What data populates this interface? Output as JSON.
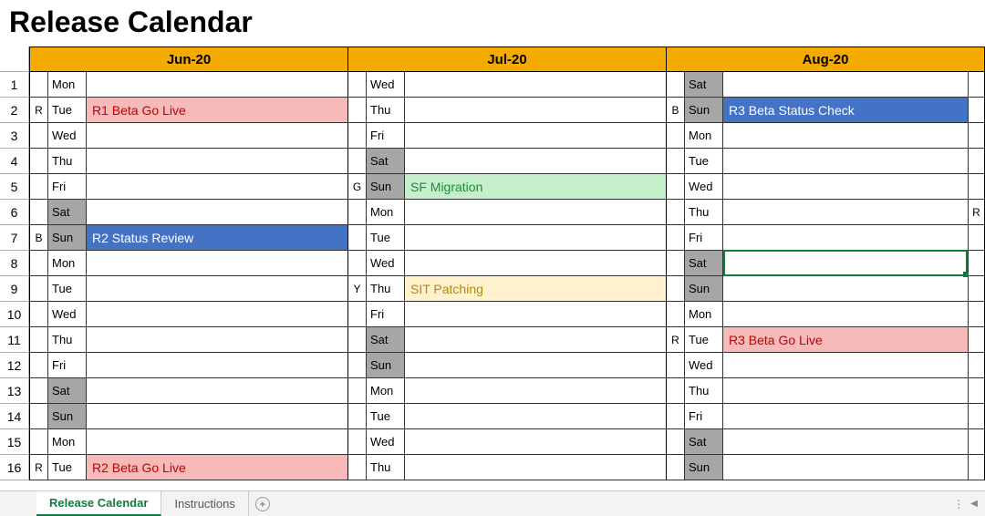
{
  "title": "Release Calendar",
  "months": [
    {
      "label": "Jun-20",
      "rows": [
        {
          "tag": "",
          "dow": "Mon",
          "wk": false,
          "event": "",
          "style": "",
          "trail": ""
        },
        {
          "tag": "R",
          "dow": "Tue",
          "wk": false,
          "event": "R1 Beta Go Live",
          "style": "red",
          "trail": ""
        },
        {
          "tag": "",
          "dow": "Wed",
          "wk": false,
          "event": "",
          "style": "",
          "trail": ""
        },
        {
          "tag": "",
          "dow": "Thu",
          "wk": false,
          "event": "",
          "style": "",
          "trail": ""
        },
        {
          "tag": "",
          "dow": "Fri",
          "wk": false,
          "event": "",
          "style": "",
          "trail": ""
        },
        {
          "tag": "",
          "dow": "Sat",
          "wk": true,
          "event": "",
          "style": "",
          "trail": ""
        },
        {
          "tag": "B",
          "dow": "Sun",
          "wk": true,
          "event": "R2 Status Review",
          "style": "blue",
          "trail": ""
        },
        {
          "tag": "",
          "dow": "Mon",
          "wk": false,
          "event": "",
          "style": "",
          "trail": ""
        },
        {
          "tag": "",
          "dow": "Tue",
          "wk": false,
          "event": "",
          "style": "",
          "trail": ""
        },
        {
          "tag": "",
          "dow": "Wed",
          "wk": false,
          "event": "",
          "style": "",
          "trail": ""
        },
        {
          "tag": "",
          "dow": "Thu",
          "wk": false,
          "event": "",
          "style": "",
          "trail": ""
        },
        {
          "tag": "",
          "dow": "Fri",
          "wk": false,
          "event": "",
          "style": "",
          "trail": ""
        },
        {
          "tag": "",
          "dow": "Sat",
          "wk": true,
          "event": "",
          "style": "",
          "trail": ""
        },
        {
          "tag": "",
          "dow": "Sun",
          "wk": true,
          "event": "",
          "style": "",
          "trail": ""
        },
        {
          "tag": "",
          "dow": "Mon",
          "wk": false,
          "event": "",
          "style": "",
          "trail": ""
        },
        {
          "tag": "R",
          "dow": "Tue",
          "wk": false,
          "event": "R2 Beta Go Live",
          "style": "red",
          "trail": ""
        }
      ]
    },
    {
      "label": "Jul-20",
      "rows": [
        {
          "tag": "",
          "dow": "Wed",
          "wk": false,
          "event": "",
          "style": "",
          "trail": ""
        },
        {
          "tag": "",
          "dow": "Thu",
          "wk": false,
          "event": "",
          "style": "",
          "trail": ""
        },
        {
          "tag": "",
          "dow": "Fri",
          "wk": false,
          "event": "",
          "style": "",
          "trail": ""
        },
        {
          "tag": "",
          "dow": "Sat",
          "wk": true,
          "event": "",
          "style": "",
          "trail": ""
        },
        {
          "tag": "G",
          "dow": "Sun",
          "wk": true,
          "event": "SF Migration",
          "style": "green",
          "trail": ""
        },
        {
          "tag": "",
          "dow": "Mon",
          "wk": false,
          "event": "",
          "style": "",
          "trail": ""
        },
        {
          "tag": "",
          "dow": "Tue",
          "wk": false,
          "event": "",
          "style": "",
          "trail": ""
        },
        {
          "tag": "",
          "dow": "Wed",
          "wk": false,
          "event": "",
          "style": "",
          "trail": ""
        },
        {
          "tag": "Y",
          "dow": "Thu",
          "wk": false,
          "event": "SIT Patching",
          "style": "yellow",
          "trail": ""
        },
        {
          "tag": "",
          "dow": "Fri",
          "wk": false,
          "event": "",
          "style": "",
          "trail": ""
        },
        {
          "tag": "",
          "dow": "Sat",
          "wk": true,
          "event": "",
          "style": "",
          "trail": ""
        },
        {
          "tag": "",
          "dow": "Sun",
          "wk": true,
          "event": "",
          "style": "",
          "trail": ""
        },
        {
          "tag": "",
          "dow": "Mon",
          "wk": false,
          "event": "",
          "style": "",
          "trail": ""
        },
        {
          "tag": "",
          "dow": "Tue",
          "wk": false,
          "event": "",
          "style": "",
          "trail": ""
        },
        {
          "tag": "",
          "dow": "Wed",
          "wk": false,
          "event": "",
          "style": "",
          "trail": ""
        },
        {
          "tag": "",
          "dow": "Thu",
          "wk": false,
          "event": "",
          "style": "",
          "trail": ""
        }
      ]
    },
    {
      "label": "Aug-20",
      "rows": [
        {
          "tag": "",
          "dow": "Sat",
          "wk": true,
          "event": "",
          "style": "",
          "trail": ""
        },
        {
          "tag": "B",
          "dow": "Sun",
          "wk": true,
          "event": "R3 Beta Status Check",
          "style": "blue",
          "trail": ""
        },
        {
          "tag": "",
          "dow": "Mon",
          "wk": false,
          "event": "",
          "style": "",
          "trail": ""
        },
        {
          "tag": "",
          "dow": "Tue",
          "wk": false,
          "event": "",
          "style": "",
          "trail": ""
        },
        {
          "tag": "",
          "dow": "Wed",
          "wk": false,
          "event": "",
          "style": "",
          "trail": ""
        },
        {
          "tag": "",
          "dow": "Thu",
          "wk": false,
          "event": "",
          "style": "",
          "trail": "R"
        },
        {
          "tag": "",
          "dow": "Fri",
          "wk": false,
          "event": "",
          "style": "",
          "trail": ""
        },
        {
          "tag": "",
          "dow": "Sat",
          "wk": true,
          "event": "",
          "style": "",
          "trail": "",
          "selected": true
        },
        {
          "tag": "",
          "dow": "Sun",
          "wk": true,
          "event": "",
          "style": "",
          "trail": ""
        },
        {
          "tag": "",
          "dow": "Mon",
          "wk": false,
          "event": "",
          "style": "",
          "trail": ""
        },
        {
          "tag": "R",
          "dow": "Tue",
          "wk": false,
          "event": "R3 Beta Go Live",
          "style": "red",
          "trail": ""
        },
        {
          "tag": "",
          "dow": "Wed",
          "wk": false,
          "event": "",
          "style": "",
          "trail": ""
        },
        {
          "tag": "",
          "dow": "Thu",
          "wk": false,
          "event": "",
          "style": "",
          "trail": ""
        },
        {
          "tag": "",
          "dow": "Fri",
          "wk": false,
          "event": "",
          "style": "",
          "trail": ""
        },
        {
          "tag": "",
          "dow": "Sat",
          "wk": true,
          "event": "",
          "style": "",
          "trail": ""
        },
        {
          "tag": "",
          "dow": "Sun",
          "wk": true,
          "event": "",
          "style": "",
          "trail": ""
        }
      ]
    }
  ],
  "row_numbers": [
    1,
    2,
    3,
    4,
    5,
    6,
    7,
    8,
    9,
    10,
    11,
    12,
    13,
    14,
    15,
    16
  ],
  "tabs": {
    "active": "Release Calendar",
    "inactive": "Instructions",
    "add_glyph": "+"
  },
  "scroll": {
    "dots": "⋮",
    "arrow": "◀"
  }
}
